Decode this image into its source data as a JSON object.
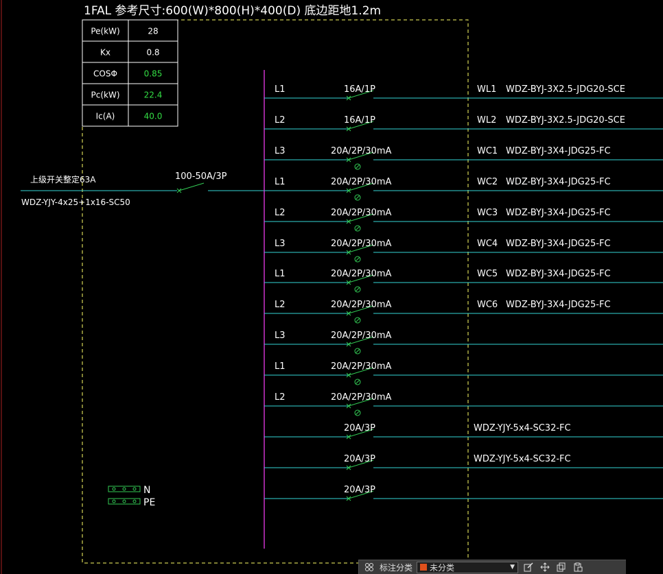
{
  "panel": {
    "title": "1FAL 参考尺寸:600(W)*800(H)*400(D) 底边距地1.2m",
    "params": [
      {
        "label": "Pe(kW)",
        "value": "28",
        "highlight": false
      },
      {
        "label": "Kx",
        "value": "0.8",
        "highlight": false
      },
      {
        "label": "COSΦ",
        "value": "0.85",
        "highlight": true
      },
      {
        "label": "Pc(kW)",
        "value": "22.4",
        "highlight": true
      },
      {
        "label": "Ic(A)",
        "value": "40.0",
        "highlight": true
      }
    ]
  },
  "incoming": {
    "upstream_label": "上级开关整定63A",
    "cable": "WDZ-YJY-4x25+1x16-SC50",
    "main_breaker": "100-50A/3P"
  },
  "circuits": [
    {
      "phase": "L1",
      "breaker": "16A/1P",
      "rcd": false,
      "id": "WL1",
      "cable": "WDZ-BYJ-3X2.5-JDG20-SCE"
    },
    {
      "phase": "L2",
      "breaker": "16A/1P",
      "rcd": false,
      "id": "WL2",
      "cable": "WDZ-BYJ-3X2.5-JDG20-SCE"
    },
    {
      "phase": "L3",
      "breaker": "20A/2P/30mA",
      "rcd": true,
      "id": "WC1",
      "cable": "WDZ-BYJ-3X4-JDG25-FC"
    },
    {
      "phase": "L1",
      "breaker": "20A/2P/30mA",
      "rcd": true,
      "id": "WC2",
      "cable": "WDZ-BYJ-3X4-JDG25-FC"
    },
    {
      "phase": "L2",
      "breaker": "20A/2P/30mA",
      "rcd": true,
      "id": "WC3",
      "cable": "WDZ-BYJ-3X4-JDG25-FC"
    },
    {
      "phase": "L3",
      "breaker": "20A/2P/30mA",
      "rcd": true,
      "id": "WC4",
      "cable": "WDZ-BYJ-3X4-JDG25-FC"
    },
    {
      "phase": "L1",
      "breaker": "20A/2P/30mA",
      "rcd": true,
      "id": "WC5",
      "cable": "WDZ-BYJ-3X4-JDG25-FC"
    },
    {
      "phase": "L2",
      "breaker": "20A/2P/30mA",
      "rcd": true,
      "id": "WC6",
      "cable": "WDZ-BYJ-3X4-JDG25-FC"
    },
    {
      "phase": "L3",
      "breaker": "20A/2P/30mA",
      "rcd": true,
      "id": "",
      "cable": ""
    },
    {
      "phase": "L1",
      "breaker": "20A/2P/30mA",
      "rcd": true,
      "id": "",
      "cable": ""
    },
    {
      "phase": "L2",
      "breaker": "20A/2P/30mA",
      "rcd": true,
      "id": "",
      "cable": ""
    },
    {
      "phase": "",
      "breaker": "20A/3P",
      "rcd": false,
      "id": "",
      "cable": "WDZ-YJY-5x4-SC32-FC"
    },
    {
      "phase": "",
      "breaker": "20A/3P",
      "rcd": false,
      "id": "",
      "cable": "WDZ-YJY-5x4-SC32-FC"
    },
    {
      "phase": "",
      "breaker": "20A/3P",
      "rcd": false,
      "id": "",
      "cable": ""
    }
  ],
  "terminals": [
    {
      "label": "N"
    },
    {
      "label": "PE"
    }
  ],
  "toolbar": {
    "category_label": "标注分类",
    "category_value": "未分类",
    "swatch_color": "#e0501c",
    "icons": [
      "annotation-icon",
      "edit-icon",
      "move-icon",
      "copy-icon",
      "paste-icon"
    ]
  },
  "colors": {
    "frame": "#ffff66",
    "wire": "#33d6d6",
    "switch": "#33cc55",
    "busbar": "#cc33cc",
    "value_highlight": "#33dd44",
    "text": "#ffffff"
  }
}
